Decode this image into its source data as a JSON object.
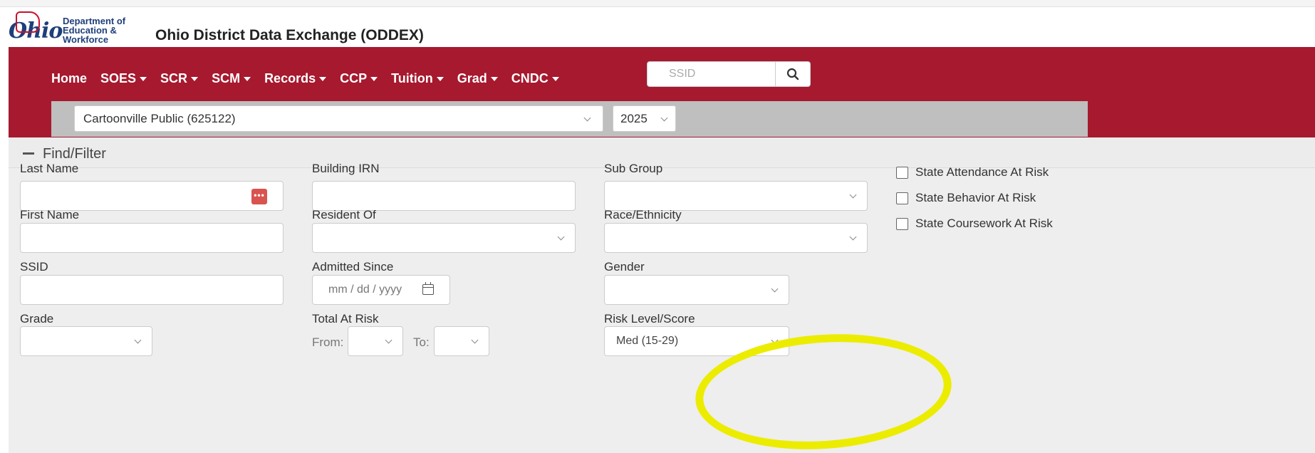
{
  "header": {
    "logo_text": "Ohio",
    "dept_line1": "Department of",
    "dept_line2": "Education &",
    "dept_line3": "Workforce",
    "app_title": "Ohio District Data Exchange (ODDEX)"
  },
  "nav": {
    "items": [
      {
        "label": "Home",
        "dropdown": false
      },
      {
        "label": "SOES",
        "dropdown": true
      },
      {
        "label": "SCR",
        "dropdown": true
      },
      {
        "label": "SCM",
        "dropdown": true
      },
      {
        "label": "Records",
        "dropdown": true
      },
      {
        "label": "CCP",
        "dropdown": true
      },
      {
        "label": "Tuition",
        "dropdown": true
      },
      {
        "label": "Grad",
        "dropdown": true
      },
      {
        "label": "CNDC",
        "dropdown": true
      }
    ],
    "search_placeholder": "SSID",
    "search_icon": "search-icon"
  },
  "context": {
    "district": "Cartoonville Public (625122)",
    "year": "2025"
  },
  "filter": {
    "title": "Find/Filter",
    "last_name_label": "Last Name",
    "first_name_label": "First Name",
    "ssid_label": "SSID",
    "grade_label": "Grade",
    "building_irn_label": "Building IRN",
    "resident_of_label": "Resident Of",
    "admitted_since_label": "Admitted Since",
    "admitted_since_placeholder": "mm / dd / yyyy",
    "total_at_risk_label": "Total At Risk",
    "from_label": "From:",
    "to_label": "To:",
    "sub_group_label": "Sub Group",
    "race_label": "Race/Ethnicity",
    "gender_label": "Gender",
    "risk_level_label": "Risk Level/Score",
    "risk_level_value": "Med (15-29)",
    "checkboxes": [
      {
        "label": "State Attendance At Risk",
        "checked": false
      },
      {
        "label": "State Behavior At Risk",
        "checked": false
      },
      {
        "label": "State Coursework At Risk",
        "checked": false
      }
    ]
  },
  "colors": {
    "brand_red": "#a6192e",
    "highlight": "#ecec00"
  }
}
